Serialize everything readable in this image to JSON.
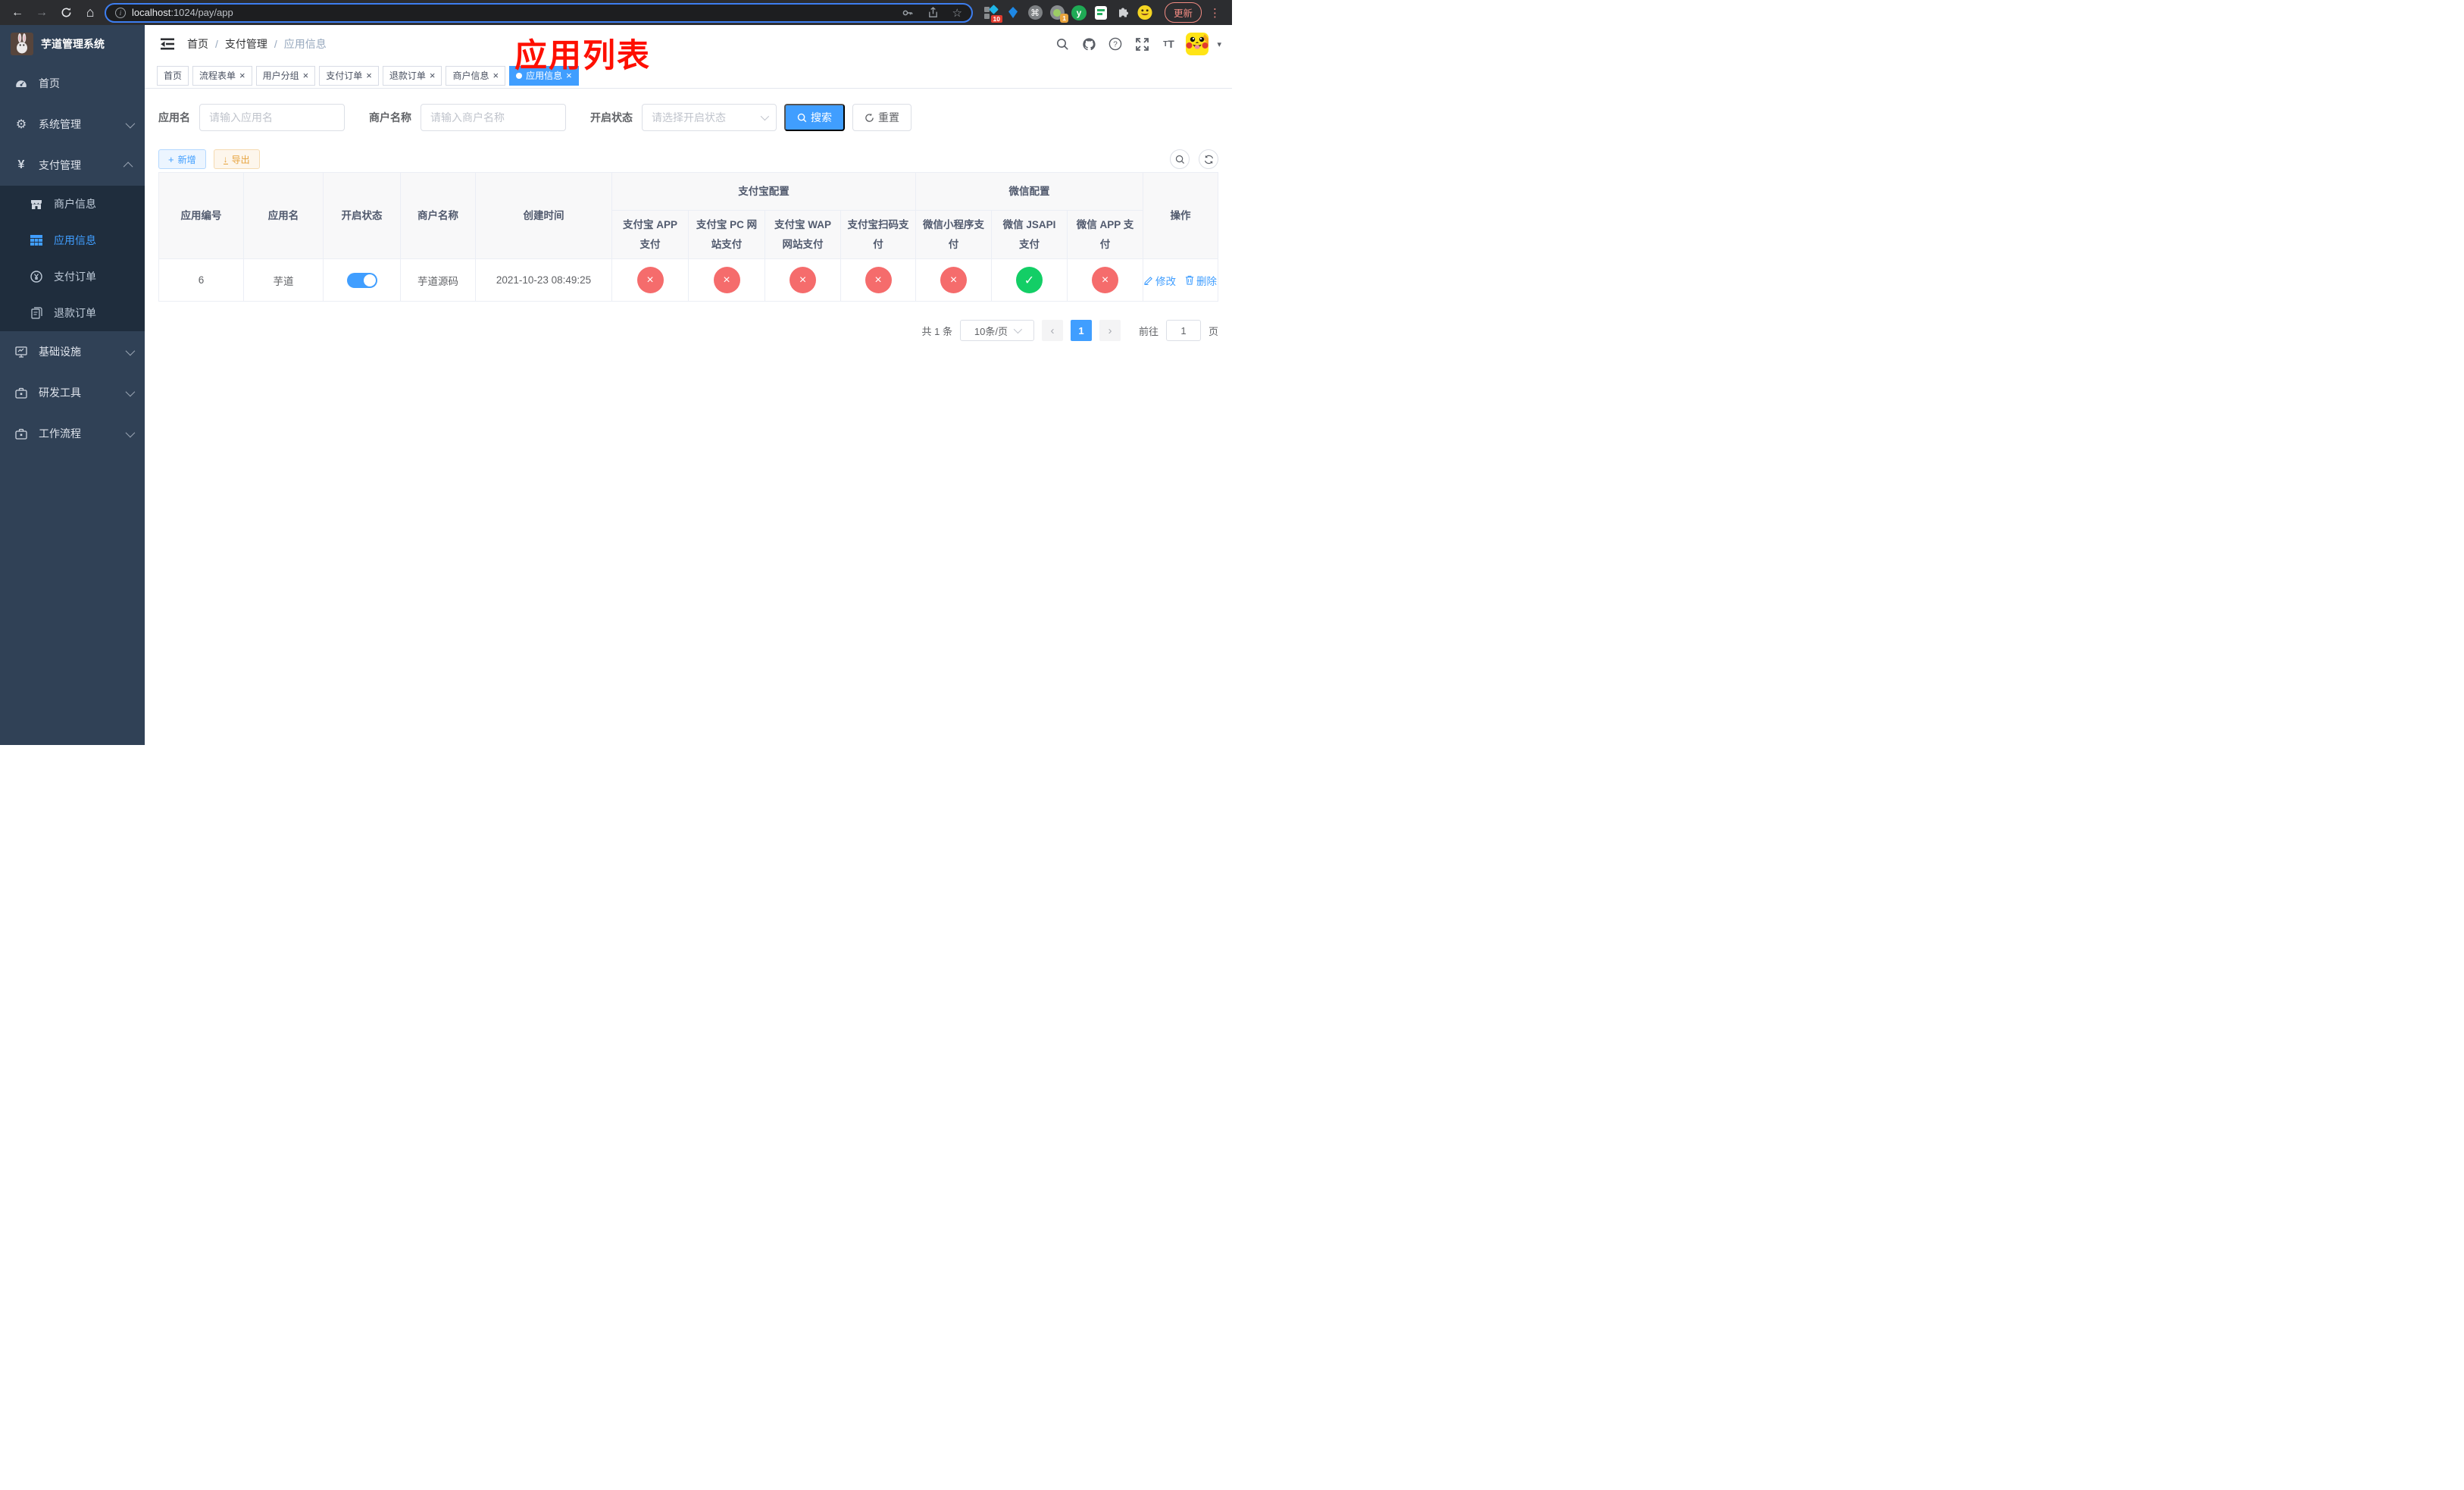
{
  "browser": {
    "url_host": "localhost",
    "url_path": ":1024/pay/app",
    "update_label": "更新",
    "ext_badge_tasks": "10",
    "ext_badge_lens": "1",
    "ext_y_label": "y"
  },
  "icons": {
    "back": "←",
    "forward": "→",
    "home": "⌂",
    "info": "i",
    "star": "☆",
    "command": "⌘",
    "dots": "⋮",
    "caret": "▾",
    "close": "×",
    "plus": "+",
    "download": "↓",
    "prev": "‹",
    "next": "›",
    "cross": "×",
    "check": "✓"
  },
  "sidebar": {
    "title": "芋道管理系统",
    "items": [
      {
        "label": "首页"
      },
      {
        "label": "系统管理"
      },
      {
        "label": "支付管理"
      },
      {
        "label": "商户信息"
      },
      {
        "label": "应用信息"
      },
      {
        "label": "支付订单"
      },
      {
        "label": "退款订单"
      },
      {
        "label": "基础设施"
      },
      {
        "label": "研发工具"
      },
      {
        "label": "工作流程"
      }
    ]
  },
  "header": {
    "breadcrumb": {
      "home": "首页",
      "section": "支付管理",
      "page": "应用信息"
    },
    "annotation": "应用列表"
  },
  "tabs": [
    {
      "label": "首页"
    },
    {
      "label": "流程表单"
    },
    {
      "label": "用户分组"
    },
    {
      "label": "支付订单"
    },
    {
      "label": "退款订单"
    },
    {
      "label": "商户信息"
    },
    {
      "label": "应用信息"
    }
  ],
  "filters": {
    "name_label": "应用名",
    "name_placeholder": "请输入应用名",
    "merchant_label": "商户名称",
    "merchant_placeholder": "请输入商户名称",
    "status_label": "开启状态",
    "status_placeholder": "请选择开启状态",
    "search_label": "搜索",
    "reset_label": "重置"
  },
  "toolbar": {
    "add_label": "新增",
    "export_label": "导出"
  },
  "table": {
    "group_alipay": "支付宝配置",
    "group_wechat": "微信配置",
    "col_id": "应用编号",
    "col_name": "应用名",
    "col_status": "开启状态",
    "col_merchant": "商户名称",
    "col_created": "创建时间",
    "col_alipay_app": "支付宝 APP 支付",
    "col_alipay_pc": "支付宝 PC 网站支付",
    "col_alipay_wap": "支付宝 WAP 网站支付",
    "col_alipay_qr": "支付宝扫码支付",
    "col_wx_mini": "微信小程序支付",
    "col_wx_jsapi": "微信 JSAPI 支付",
    "col_wx_app": "微信 APP 支付",
    "col_actions": "操作",
    "row": {
      "id": "6",
      "name": "芋道",
      "enabled_state": "on",
      "merchant": "芋道源码",
      "created": "2021-10-23 08:49:25",
      "pay_status": [
        {
          "state": "off",
          "glyph": "×"
        },
        {
          "state": "off",
          "glyph": "×"
        },
        {
          "state": "off",
          "glyph": "×"
        },
        {
          "state": "off",
          "glyph": "×"
        },
        {
          "state": "off",
          "glyph": "×"
        },
        {
          "state": "on",
          "glyph": "✓"
        },
        {
          "state": "off",
          "glyph": "×"
        }
      ],
      "edit_label": "修改",
      "delete_label": "删除"
    }
  },
  "pagination": {
    "total": "共 1 条",
    "per_page": "10条/页",
    "page": "1",
    "goto_label": "前往",
    "goto_value": "1",
    "unit": "页"
  }
}
